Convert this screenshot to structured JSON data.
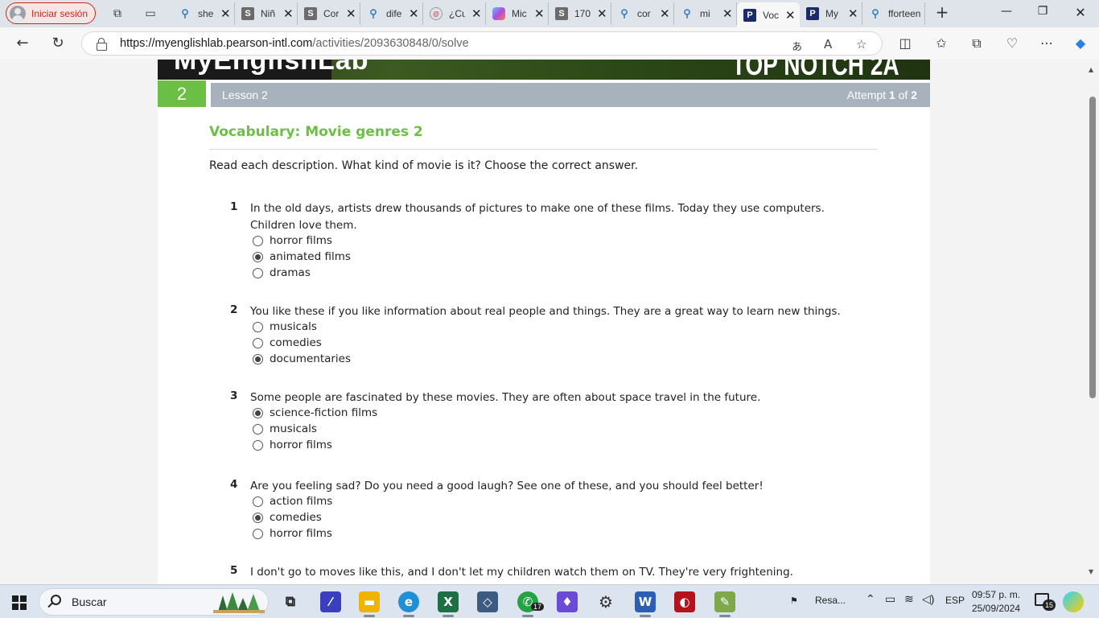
{
  "browser": {
    "profile_label": "Iniciar sesión",
    "tabs": [
      {
        "title": "she",
        "favicon": "search"
      },
      {
        "title": "Niñ",
        "favicon": "s"
      },
      {
        "title": "Cor",
        "favicon": "s"
      },
      {
        "title": "dife",
        "favicon": "search"
      },
      {
        "title": "¿Cu",
        "favicon": "c"
      },
      {
        "title": "Mic",
        "favicon": "m"
      },
      {
        "title": "170",
        "favicon": "s"
      },
      {
        "title": "cor",
        "favicon": "search"
      },
      {
        "title": "mi",
        "favicon": "search"
      },
      {
        "title": "Voc",
        "favicon": "p",
        "active": true
      },
      {
        "title": "My",
        "favicon": "p"
      },
      {
        "title": "fforteen",
        "favicon": "search"
      }
    ],
    "url_host": "https://myenglishlab.pearson-intl.com",
    "url_path": "/activities/2093630848/0/solve"
  },
  "page": {
    "banner_logo": "MyEnglishLab",
    "banner_course": "TOP NOTCH 2A",
    "lesson_number": "2",
    "lesson_label": "Lesson 2",
    "attempt_prefix": "Attempt ",
    "attempt_current": "1",
    "attempt_of": " of ",
    "attempt_total": "2",
    "title": "Vocabulary: Movie genres 2",
    "instructions": "Read each description. What kind of movie is it? Choose the correct answer.",
    "questions": [
      {
        "num": "1",
        "stem": "In the old days, artists drew thousands of pictures to make one of these films. Today they use computers. Children love them.",
        "options": [
          "horror films",
          "animated films",
          "dramas"
        ],
        "selected": 1
      },
      {
        "num": "2",
        "stem": "You like these if you like information about real people and things. They are a great way to learn new things.",
        "options": [
          "musicals",
          "comedies",
          "documentaries"
        ],
        "selected": 2
      },
      {
        "num": "3",
        "stem": "Some people are fascinated by these movies. They are often about space travel in the future.",
        "options": [
          "science-fiction films",
          "musicals",
          "horror films"
        ],
        "selected": 0
      },
      {
        "num": "4",
        "stem": "Are you feeling sad? Do you need a good laugh? See one of these, and you should feel better!",
        "options": [
          "action films",
          "comedies",
          "horror films"
        ],
        "selected": 1
      },
      {
        "num": "5",
        "stem": "I don't go to moves like this, and I don't let my children watch them on TV. They're very frightening.",
        "options": [],
        "selected": null
      }
    ]
  },
  "taskbar": {
    "search_placeholder": "Buscar",
    "whatsapp_badge": "17",
    "weather_label": "Resa...",
    "language": "ESP",
    "time": "09:57 p. m.",
    "date": "25/09/2024",
    "notification_count": "15"
  }
}
